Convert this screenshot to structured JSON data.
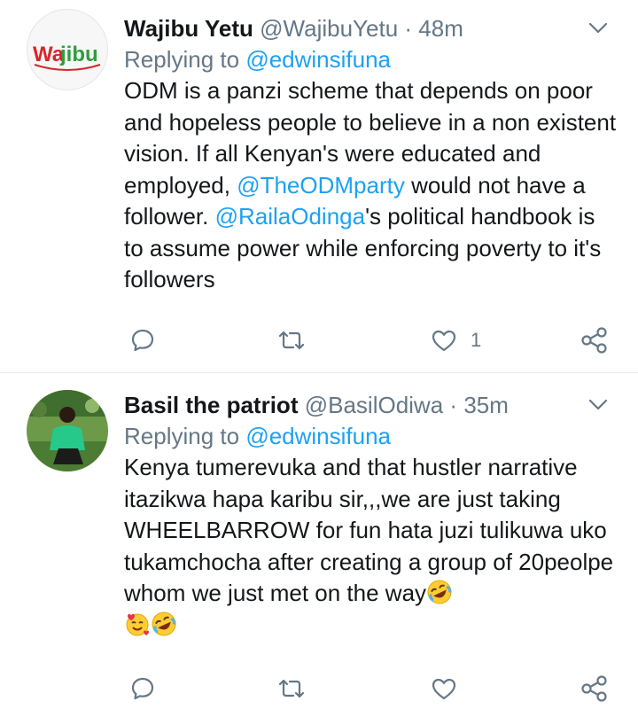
{
  "tweets": [
    {
      "display_name": "Wajibu Yetu",
      "handle": "@WajibuYetu",
      "separator": "·",
      "time": "48m",
      "avatar_text": "Wajibu",
      "replying_prefix": "Replying to",
      "replying_to": "@edwinsifuna",
      "text": {
        "part1": "ODM is a panzi scheme that depends on poor and hopeless people to believe in a non existent vision. If all Kenyan's were educated and employed, ",
        "mention1": "@TheODMparty",
        "part2": " would not have a follower. ",
        "mention2": "@RailaOdinga",
        "part3": "'s political handbook is to assume power while enforcing poverty to it's followers"
      },
      "like_count": "1"
    },
    {
      "display_name": "Basil the patriot",
      "handle": "@BasilOdiwa",
      "separator": "·",
      "time": "35m",
      "replying_prefix": "Replying to",
      "replying_to": "@edwinsifuna",
      "text": {
        "main": "Kenya tumerevuka and that hustler narrative itazikwa hapa karibu sir,,,we are just taking WHEELBARROW for fun hata juzi tulikuwa uko tukamchocha after creating a group of 20peolpe whom we just met on the way"
      },
      "emojis": [
        "rolling-on-floor-laughing-emoji",
        "smiling-face-with-hearts-emoji",
        "rolling-on-floor-laughing-emoji"
      ]
    }
  ],
  "colors": {
    "link": "#1da1f2",
    "secondary_text": "#657786",
    "primary_text": "#14171a",
    "divider": "#e6ecf0",
    "logo_red": "#d7262b",
    "logo_green": "#2e9e3e"
  }
}
